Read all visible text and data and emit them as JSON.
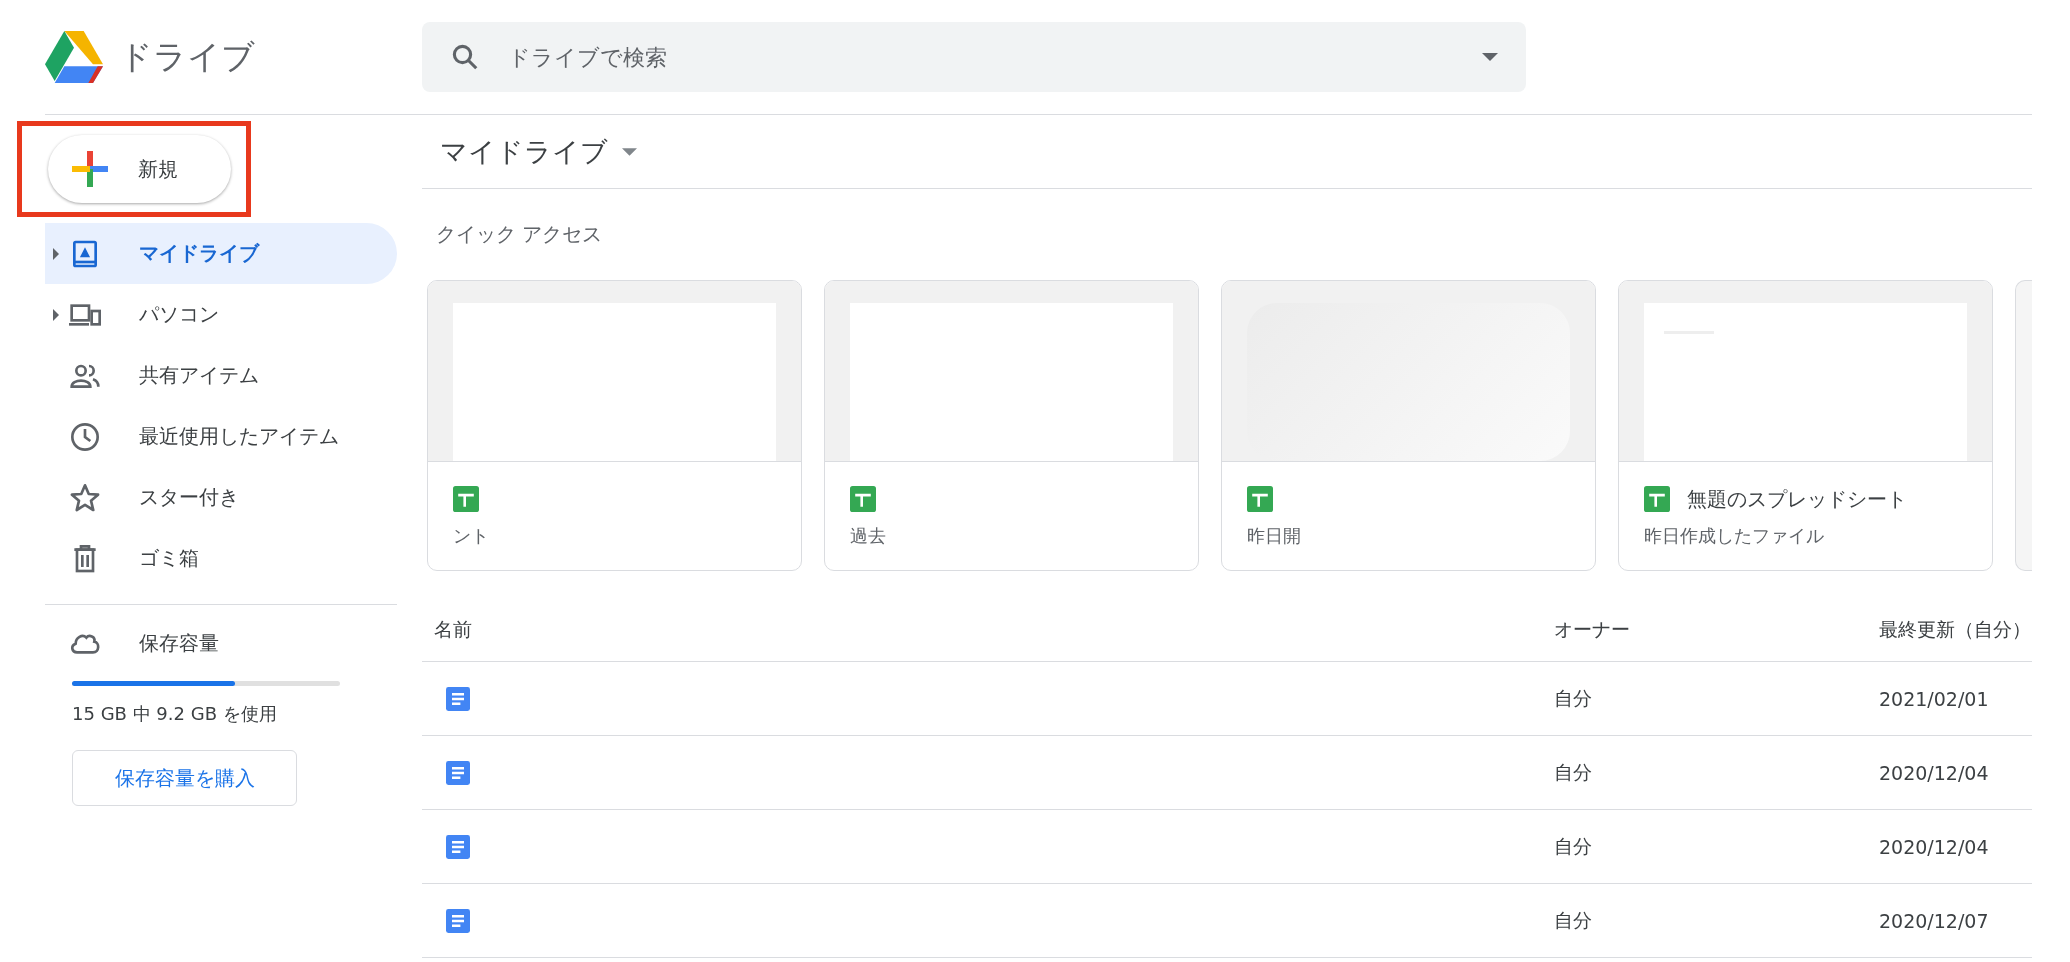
{
  "app": {
    "title": "ドライブ"
  },
  "search": {
    "placeholder": "ドライブで検索"
  },
  "new_button": {
    "label": "新規"
  },
  "sidebar": {
    "items": [
      {
        "label": "マイドライブ",
        "kind": "drive",
        "expandable": true,
        "selected": true
      },
      {
        "label": "パソコン",
        "kind": "computer",
        "expandable": true,
        "selected": false
      },
      {
        "label": "共有アイテム",
        "kind": "shared",
        "expandable": false,
        "selected": false
      },
      {
        "label": "最近使用したアイテム",
        "kind": "recent",
        "expandable": false,
        "selected": false
      },
      {
        "label": "スター付き",
        "kind": "star",
        "expandable": false,
        "selected": false
      },
      {
        "label": "ゴミ箱",
        "kind": "trash",
        "expandable": false,
        "selected": false
      }
    ]
  },
  "storage": {
    "label": "保存容量",
    "level": 0.61,
    "usage": "15 GB 中 9.2 GB を使用",
    "buy_button": "保存容量を購入"
  },
  "breadcrumb": {
    "title": "マイドライブ"
  },
  "quick_access": {
    "title": "クイック アクセス",
    "cards": [
      {
        "subtitle": "ント",
        "kind": "blank"
      },
      {
        "subtitle": "過去",
        "kind": "blank"
      },
      {
        "subtitle": "昨日開",
        "kind": "smudged"
      },
      {
        "name": "無題のスプレッドシート",
        "subtitle": "昨日作成したファイル",
        "kind": "sheet"
      }
    ]
  },
  "table": {
    "columns": [
      "名前",
      "オーナー",
      "最終更新（自分）"
    ],
    "rows": [
      {
        "owner": "自分",
        "modified": "2021/02/01"
      },
      {
        "owner": "自分",
        "modified": "2020/12/04"
      },
      {
        "owner": "自分",
        "modified": "2020/12/04"
      },
      {
        "owner": "自分",
        "modified": "2020/12/07"
      }
    ]
  }
}
